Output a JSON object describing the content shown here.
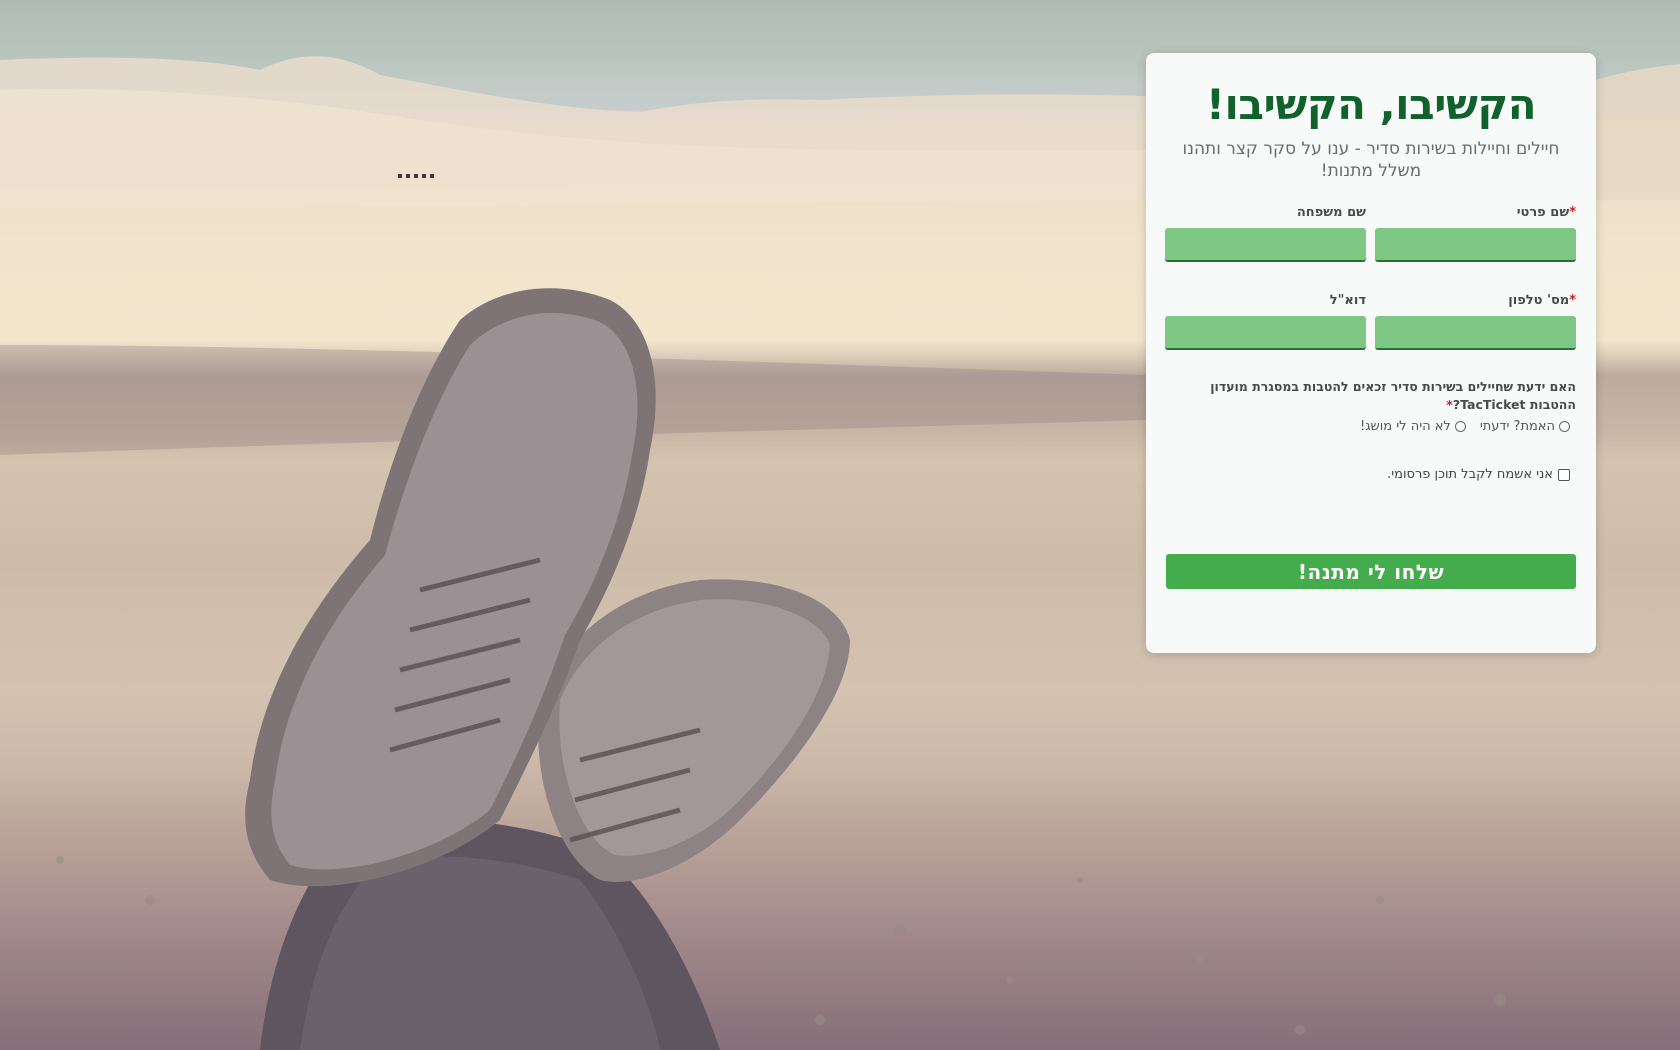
{
  "background": {
    "image": "desert-boots-photo"
  },
  "form": {
    "title": "הקשיבו, הקשיבו!",
    "subtitle": "חיילים וחיילות בשירות סדיר - ענו על סקר קצר ותהנו משלל מתנות!",
    "fields": {
      "first_name": {
        "label": "שם פרטי",
        "required_mark": "*",
        "value": ""
      },
      "last_name": {
        "label": "שם משפחה",
        "value": ""
      },
      "phone": {
        "label": "מס' טלפון",
        "required_mark": "*",
        "value": ""
      },
      "email": {
        "label": "דוא\"ל",
        "value": ""
      }
    },
    "question": {
      "text": "האם ידעת שחיילים בשירות סדיר זכאים להטבות במסגרת מועדון ההטבות TacTicket?",
      "required_mark": "*",
      "options": [
        "האמת? ידעתי",
        "לא היה לי מושג!"
      ]
    },
    "consent_label": "אני אשמח לקבל תוכן פרסומי.",
    "submit_label": "שלחו לי מתנה!"
  },
  "colors": {
    "title": "#10622c",
    "input_fill": "#7fc785",
    "button": "#45ac4d",
    "card": "#f8f9f9",
    "required": "#d21c1c"
  }
}
